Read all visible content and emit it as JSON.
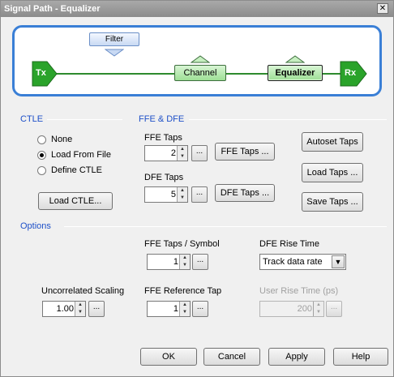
{
  "window": {
    "title": "Signal Path - Equalizer",
    "close": "✕"
  },
  "diagram": {
    "tx": "Tx",
    "rx": "Rx",
    "filter": "Filter",
    "channel": "Channel",
    "equalizer": "Equalizer",
    "colors": {
      "border": "#3a7fd6",
      "signal": "#2e8b2e"
    }
  },
  "ctle": {
    "section": "CTLE",
    "options": [
      "None",
      "Load From File",
      "Define CTLE"
    ],
    "selected": "Load From File",
    "load_button": "Load CTLE..."
  },
  "ffe_dfe": {
    "section": "FFE & DFE",
    "ffe_taps_label": "FFE Taps",
    "ffe_taps_value": "2",
    "ffe_taps_button": "FFE Taps ...",
    "dfe_taps_label": "DFE Taps",
    "dfe_taps_value": "5",
    "dfe_taps_button": "DFE Taps ...",
    "autoset_button": "Autoset Taps",
    "load_taps_button": "Load Taps ...",
    "save_taps_button": "Save Taps ...",
    "ellipsis": "..."
  },
  "options": {
    "section": "Options",
    "ffe_taps_per_symbol_label": "FFE Taps / Symbol",
    "ffe_taps_per_symbol_value": "1",
    "dfe_rise_time_label": "DFE Rise Time",
    "dfe_rise_time_value": "Track data rate",
    "uncorrelated_scaling_label": "Uncorrelated Scaling",
    "uncorrelated_scaling_value": "1.00",
    "ffe_reference_tap_label": "FFE Reference Tap",
    "ffe_reference_tap_value": "1",
    "user_rise_time_label": "User Rise Time (ps)",
    "user_rise_time_value": "200"
  },
  "footer": {
    "ok": "OK",
    "cancel": "Cancel",
    "apply": "Apply",
    "help": "Help"
  }
}
